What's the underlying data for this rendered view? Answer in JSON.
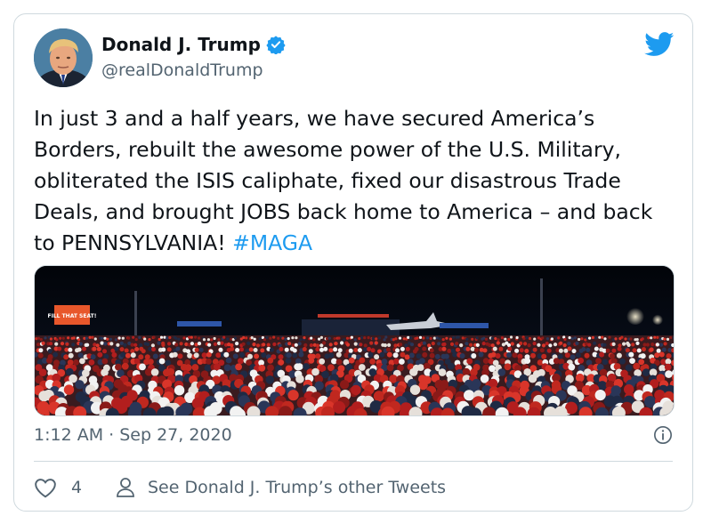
{
  "author": {
    "name": "Donald J. Trump",
    "handle": "@realDonaldTrump"
  },
  "tweet": {
    "text": "In just 3 and a half years, we have secured America’s Borders, rebuilt the awesome power of the U.S. Military, obliterated the ISIS caliphate, fixed our disastrous Trade Deals, and brought JOBS back home to America – and back to PENNSYLVANIA! ",
    "hashtag": "#MAGA",
    "timestamp": "1:12 AM · Sep 27, 2020"
  },
  "photo": {
    "sign_text": "FILL THAT SEAT!"
  },
  "footer": {
    "like_count": "4",
    "other_tweets_label": "See Donald J. Trump’s other Tweets"
  },
  "colors": {
    "accent": "#1d9bf0",
    "secondary_text": "#536471",
    "border": "#cfd9de"
  },
  "icons": [
    "twitter-bird-icon",
    "verified-badge-icon",
    "info-icon",
    "heart-icon",
    "person-icon"
  ]
}
